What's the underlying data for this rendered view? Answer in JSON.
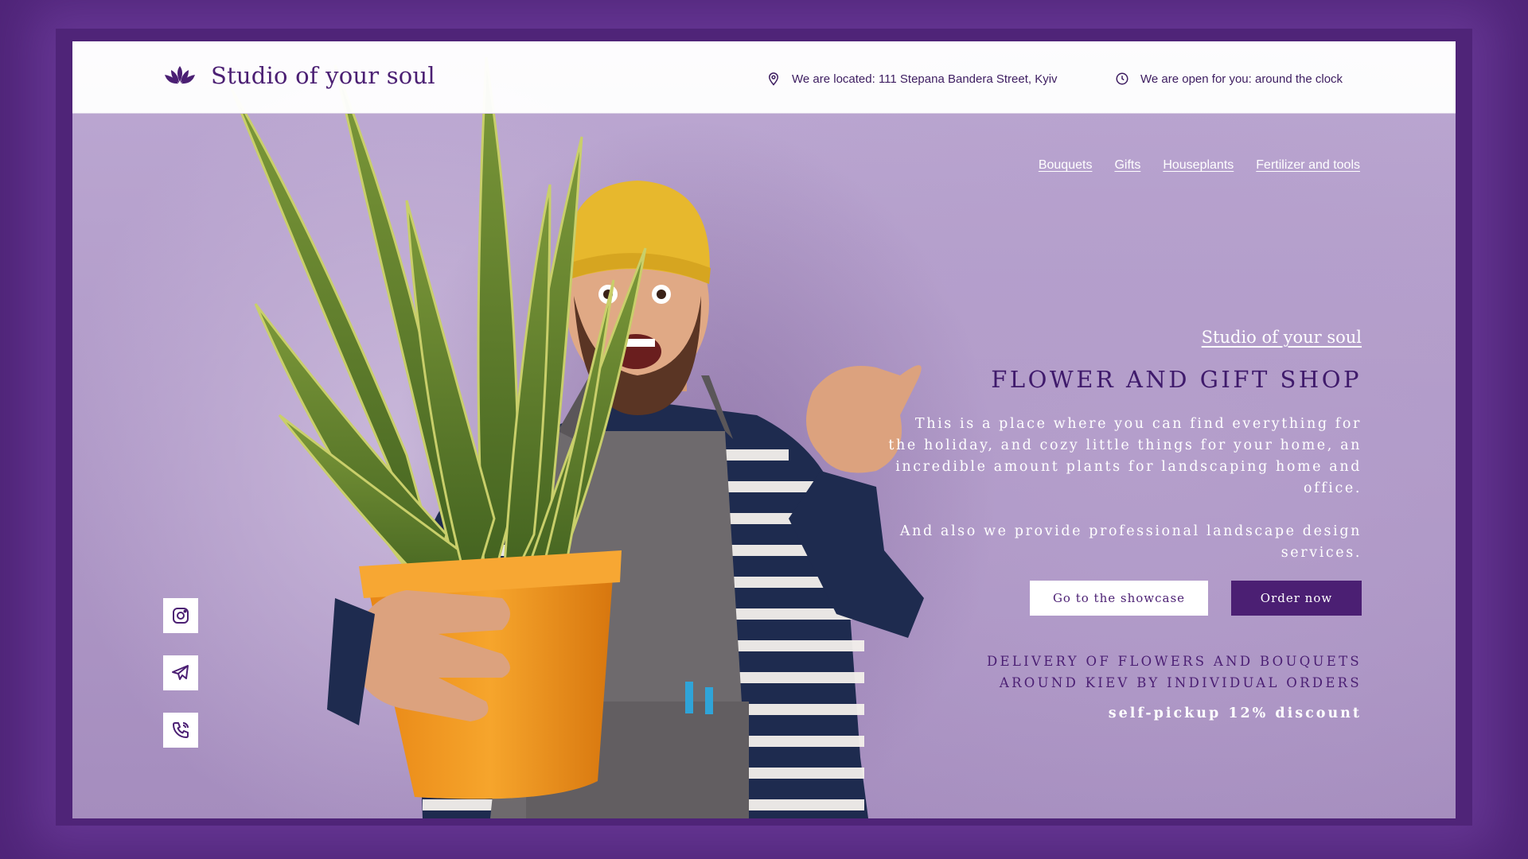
{
  "brand": {
    "name": "Studio of your soul",
    "logo_icon": "lotus-icon"
  },
  "header": {
    "location": "We are located: 111 Stepana Bandera Street, Kyiv",
    "location_icon": "map-pin-icon",
    "hours": "We are open for you: around the clock",
    "hours_icon": "clock-icon"
  },
  "nav": {
    "items": [
      {
        "label": "Bouquets"
      },
      {
        "label": "Gifts"
      },
      {
        "label": "Houseplants"
      },
      {
        "label": "Fertilizer and tools"
      }
    ]
  },
  "hero": {
    "tagline": "Studio of your soul",
    "title": "FLOWER AND GIFT SHOP",
    "description_1": "This is a place where you can find everything for the holiday, and cozy little things for your home, an incredible amount plants for landscaping home and office.",
    "description_2": "And also we provide professional landscape design services.",
    "btn_showcase": "Go to the showcase",
    "btn_order": "Order now",
    "delivery_line_1": "DELIVERY OF FLOWERS AND BOUQUETS",
    "delivery_line_2": "AROUND KIEV BY INDIVIDUAL ORDERS",
    "pickup": "self-pickup 12% discount"
  },
  "socials": [
    {
      "icon": "instagram-icon"
    },
    {
      "icon": "telegram-icon"
    },
    {
      "icon": "phone-icon"
    }
  ],
  "colors": {
    "brand_purple": "#4b1f73",
    "outer_background": "#4f2478",
    "hero_background": "#b6a0c8",
    "pot_orange": "#f0931f",
    "hat_yellow": "#e7b82d"
  }
}
